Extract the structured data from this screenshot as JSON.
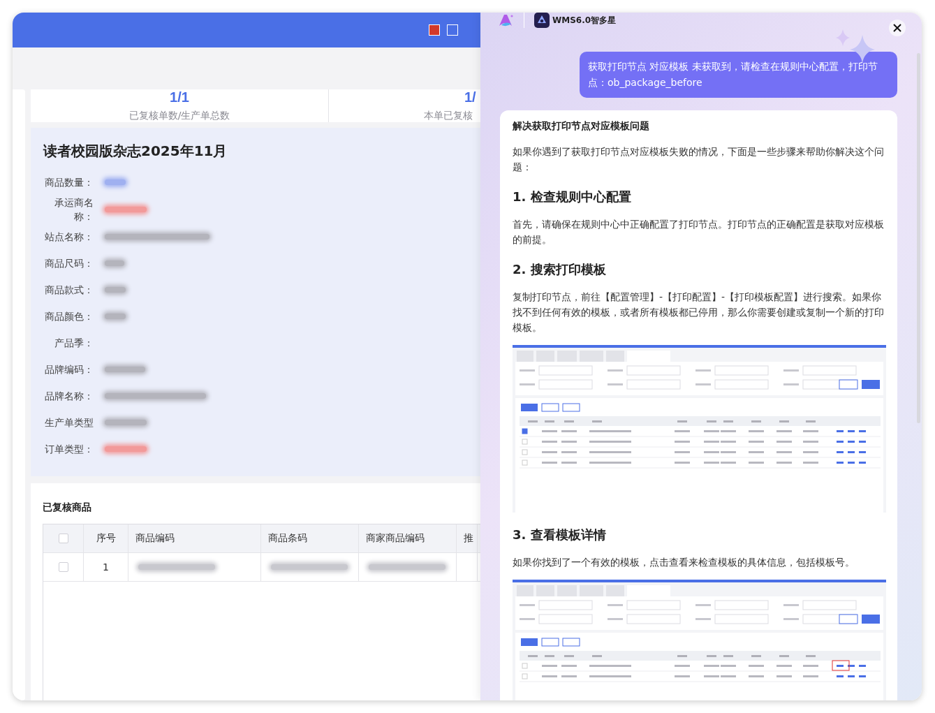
{
  "window_buttons": [
    {
      "color": "#d3392a"
    },
    {
      "color": "#4a6fe6"
    }
  ],
  "stats": [
    {
      "value": "1/1",
      "label": "已复核单数/生产单总数"
    },
    {
      "value": "1/",
      "label": "本单已复核"
    }
  ],
  "product": {
    "title": "读者校园版杂志2025年11月",
    "fields": [
      {
        "label": "商品数量：",
        "color": "#9fb0f0"
      },
      {
        "label": "承运商名称：",
        "color": "#f29a9a"
      },
      {
        "label": "站点名称：",
        "color": "#b4b4bc"
      },
      {
        "label": "商品尺码：",
        "color": "#b4b4bc"
      },
      {
        "label": "商品款式：",
        "color": "#b4b4bc"
      },
      {
        "label": "商品颜色：",
        "color": "#b4b4bc"
      },
      {
        "label": "产品季："
      },
      {
        "label": "品牌编码：",
        "color": "#b4b4bc"
      },
      {
        "label": "品牌名称：",
        "color": "#b4b4bc"
      },
      {
        "label": "生产单类型",
        "color": "#b4b4bc"
      },
      {
        "label": "订单类型：",
        "color": "#f29a9a"
      }
    ]
  },
  "goods": {
    "title": "已复核商品",
    "columns": [
      {
        "kind": "check"
      },
      {
        "label": "序号",
        "kind": "index"
      },
      {
        "label": "商品编码",
        "kind": "text"
      },
      {
        "label": "商品条码",
        "kind": "text"
      },
      {
        "label": "商家商品编码",
        "kind": "text"
      },
      {
        "label": "推",
        "kind": "cut"
      }
    ],
    "header_checked": false,
    "rows": [
      {
        "checked": false,
        "index": "1"
      }
    ]
  },
  "assistant": {
    "name": "WMS6.0智多星",
    "question": "获取打印节点 对应模板 未获取到，请检查在规则中心配置，打印节点：ob_package_before",
    "answer": [
      {
        "kind": "title",
        "text": "解决获取打印节点对应模板问题"
      },
      {
        "kind": "paragraph",
        "text": "如果你遇到了获取打印节点对应模板失败的情况，下面是一些步骤来帮助你解决这个问题："
      },
      {
        "kind": "heading",
        "text": "1. 检查规则中心配置"
      },
      {
        "kind": "paragraph",
        "text": "首先，请确保在规则中心中正确配置了打印节点。打印节点的正确配置是获取对应模板的前提。"
      },
      {
        "kind": "heading",
        "text": "2. 搜索打印模板"
      },
      {
        "kind": "paragraph",
        "text": "复制打印节点，前往【配置管理】-【打印配置】-【打印模板配置】进行搜索。如果你找不到任何有效的模板，或者所有模板都已停用，那么你需要创建或复制一个新的打印模板。"
      },
      {
        "kind": "screenshot",
        "highlight": false,
        "rows": [
          {
            "checked": true
          },
          {
            "checked": false
          },
          {
            "checked": false
          },
          {
            "checked": false
          }
        ]
      },
      {
        "kind": "heading",
        "text": "3. 查看模板详情"
      },
      {
        "kind": "paragraph",
        "text": "如果你找到了一个有效的模板，点击查看来检查模板的具体信息，包括模板号。"
      },
      {
        "kind": "screenshot",
        "highlight": true,
        "rows": [
          {
            "checked": false
          },
          {
            "checked": false
          }
        ]
      }
    ]
  }
}
